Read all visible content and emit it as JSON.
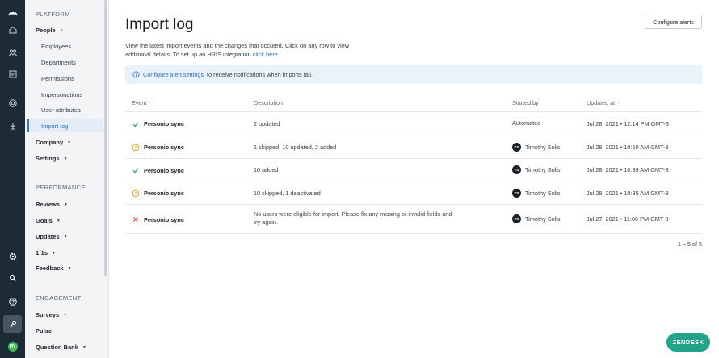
{
  "nav": {
    "platform_section": "PLATFORM",
    "people": "People",
    "people_items": [
      "Employees",
      "Departments",
      "Permissions",
      "Impersonations",
      "User attributes",
      "Import log"
    ],
    "company": "Company",
    "settings": "Settings",
    "performance_section": "PERFORMANCE",
    "reviews": "Reviews",
    "goals": "Goals",
    "updates": "Updates",
    "one_on_ones": "1:1s",
    "feedback": "Feedback",
    "engagement_section": "ENGAGEMENT",
    "surveys": "Surveys",
    "pulse": "Pulse",
    "question_bank": "Question Bank"
  },
  "rail": {
    "avatar_initials": "MY"
  },
  "header": {
    "title": "Import log",
    "configure_alerts": "Configure alerts"
  },
  "intro": {
    "text": "View the latest import events and the changes that occured. Click on any row to view additional details. To set up an HRIS integration",
    "link": "click here."
  },
  "banner": {
    "link": "Configure alert settings",
    "text": "to receive notifications when imports fail."
  },
  "table": {
    "columns": {
      "event": "Event",
      "description": "Description",
      "started_by": "Started by",
      "updated_at": "Updated at"
    },
    "rows": [
      {
        "status": "success",
        "event": "Personio sync",
        "description": "2 updated",
        "started_by": "Automated",
        "avatar": "",
        "updated_at": "Jul 28, 2021 • 12:14 PM GMT-3"
      },
      {
        "status": "warning",
        "event": "Personio sync",
        "description": "1 skipped, 10 updated, 2 added",
        "started_by": "Timothy Solis",
        "avatar": "TS",
        "updated_at": "Jul 28, 2021 • 10:50 AM GMT-3"
      },
      {
        "status": "success",
        "event": "Personio sync",
        "description": "10 added",
        "started_by": "Timothy Solis",
        "avatar": "TS",
        "updated_at": "Jul 28, 2021 • 10:39 AM GMT-3"
      },
      {
        "status": "warning",
        "event": "Personio sync",
        "description": "10 skipped, 1 deactivated",
        "started_by": "Timothy Solis",
        "avatar": "TS",
        "updated_at": "Jul 28, 2021 • 10:35 AM GMT-3"
      },
      {
        "status": "error",
        "event": "Personio sync",
        "description": "No users were eligible for import. Please fix any missing or invalid fields and try again.",
        "started_by": "Timothy Solis",
        "avatar": "TS",
        "updated_at": "Jul 27, 2021 • 11:06 PM GMT-3"
      }
    ],
    "pager": "1 – 5 of 5"
  },
  "zendesk": "ZENDESK",
  "colors": {
    "success": "#2fa84f",
    "warning": "#e69a18",
    "error": "#d9443b",
    "link": "#2f6fc8",
    "rail": "#1d2b36"
  },
  "icons": [
    "logo-icon",
    "home-icon",
    "people-icon",
    "reports-icon",
    "target-icon",
    "tree-icon",
    "gear-icon",
    "search-icon",
    "help-icon",
    "key-icon"
  ]
}
